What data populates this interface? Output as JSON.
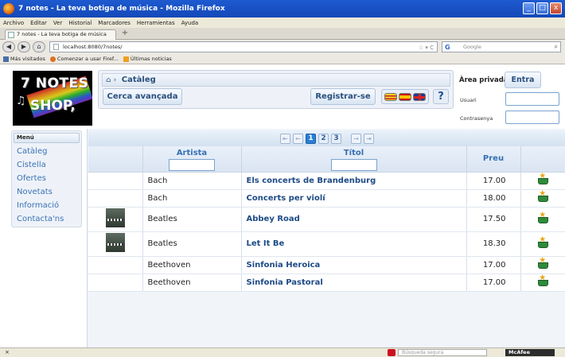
{
  "window": {
    "title": "7 notes - La teva botiga de música - Mozilla Firefox",
    "minimize": "_",
    "close": "x"
  },
  "menubar": [
    "Archivo",
    "Editar",
    "Ver",
    "Historial",
    "Marcadores",
    "Herramientas",
    "Ayuda"
  ],
  "tab": {
    "label": "7 notes - La teva botiga de música",
    "new_tab": "+"
  },
  "navbar": {
    "url": "localhost:8080/7notes/",
    "search_placeholder": "Google"
  },
  "bookmarks": [
    "Más visitados",
    "Comenzar a usar Firef...",
    "Últimas noticias"
  ],
  "logo": {
    "line1": "7 NOTES",
    "line2": "SHOP,"
  },
  "breadcrumb": {
    "label": "Catàleg"
  },
  "header": {
    "cerca": "Cerca avançada",
    "registrar": "Registrar-se",
    "help": "?"
  },
  "private_area": {
    "title": "Àrea privada",
    "entra": "Entra",
    "user_label": "Usuari",
    "password_label": "Contrasenya"
  },
  "sidebar": {
    "header": "Menú",
    "items": [
      "Catàleg",
      "Cistella",
      "Ofertes",
      "Novetats",
      "Informació",
      "Contacta'ns"
    ]
  },
  "pager": {
    "pages": [
      "1",
      "2",
      "3"
    ],
    "active": "1"
  },
  "table": {
    "headers": {
      "artist": "Artista",
      "title": "Títol",
      "price": "Preu"
    },
    "rows": [
      {
        "artist": "Bach",
        "title": "Els concerts de Brandenburg",
        "price": "17.00",
        "thumb": false
      },
      {
        "artist": "Bach",
        "title": "Concerts per violí",
        "price": "18.00",
        "thumb": false
      },
      {
        "artist": "Beatles",
        "title": "Abbey Road",
        "price": "17.50",
        "thumb": true
      },
      {
        "artist": "Beatles",
        "title": "Let It Be",
        "price": "18.30",
        "thumb": true
      },
      {
        "artist": "Beethoven",
        "title": "Sinfonia Heroica",
        "price": "17.00",
        "thumb": false
      },
      {
        "artist": "Beethoven",
        "title": "Sinfonia Pastoral",
        "price": "17.00",
        "thumb": false
      }
    ]
  },
  "statusbar": {
    "close": "×",
    "search_placeholder": "Búsqueda segura",
    "mcafee": "McAfee"
  },
  "colors": {
    "accent": "#2a7fd5",
    "link": "#3b72b6",
    "title": "#1d4a86"
  }
}
